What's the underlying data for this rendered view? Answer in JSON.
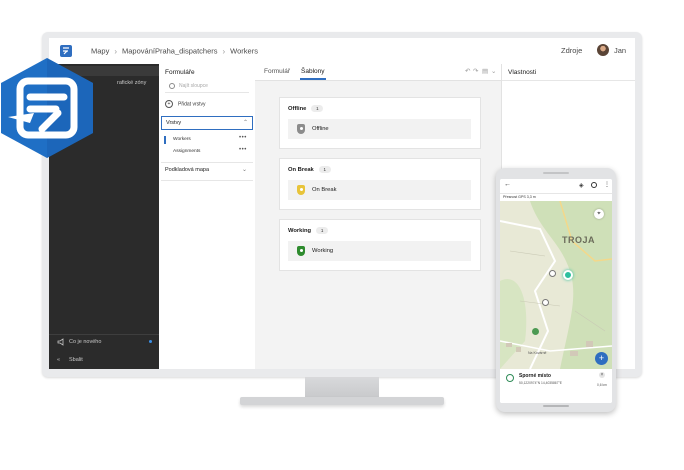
{
  "app": {
    "breadcrumbs": [
      "Mapy",
      "MapováníPraha_dispatchers",
      "Workers"
    ],
    "header_right": {
      "resources_label": "Zdroje",
      "user_name": "Jan"
    }
  },
  "side_nav": {
    "partial_label": "rafické zóny",
    "whats_new": "Co je nového",
    "collapse": "Sbalit"
  },
  "forms_panel": {
    "title": "Formuláře",
    "search_placeholder": "Najít sloupce",
    "add_layers": "Přidat vrstvy",
    "layers_section": "Vrstvy",
    "layers": [
      {
        "name": "Workers",
        "selected": true
      },
      {
        "name": "Assignments",
        "selected": false
      }
    ],
    "basemap_section": "Podkladová mapa"
  },
  "center": {
    "tabs": [
      "Formulář",
      "Šablony"
    ],
    "active_tab": "Šablony",
    "groups": [
      {
        "title": "Offline",
        "count": "1",
        "template": "Offline",
        "color": "#8c8c8c"
      },
      {
        "title": "On Break",
        "count": "1",
        "template": "On Break",
        "color": "#e8c43a"
      },
      {
        "title": "Working",
        "count": "1",
        "template": "Working",
        "color": "#2e8b2e"
      }
    ]
  },
  "properties_panel": {
    "title": "Vlastnosti"
  },
  "phone": {
    "accuracy": "Přesnost GPS 3,3 m",
    "map_place": "TROJA",
    "map_place_2": "Na Kovárně",
    "callout_title": "Sporné místo",
    "callout_coords": "50,1220974°N  14,4035867°E",
    "callout_distance": "0,6 km"
  },
  "colors": {
    "accent": "#2f6ec0",
    "logo_blue": "#1f6fc5",
    "dark_nav": "#2b2b2b"
  }
}
